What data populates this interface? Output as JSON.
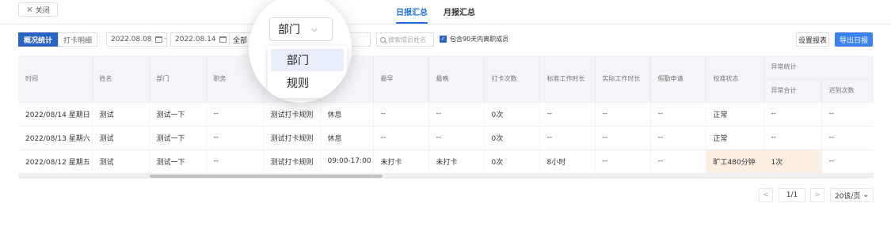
{
  "header": {
    "close_label": "关闭",
    "close_icon": "×",
    "tabs": [
      {
        "label": "日报汇总",
        "active": true
      },
      {
        "label": "月报汇总",
        "active": false
      }
    ]
  },
  "toolbar": {
    "view_tabs": [
      {
        "label": "概况统计",
        "active": true
      },
      {
        "label": "打卡明细",
        "active": false
      }
    ],
    "start_date": "2022.08.08",
    "date_separator": "-",
    "end_date": "2022.08.14",
    "scope_value": "全部",
    "search_placeholder": "搜索成员姓名",
    "include_left_label": "包含90天内离职成员",
    "include_left_checked": true,
    "settings_label": "设置报表",
    "export_label": "导出日报"
  },
  "magnifier": {
    "select_value": "部门",
    "options": [
      {
        "label": "部门",
        "selected": true
      },
      {
        "label": "规则",
        "selected": false
      }
    ]
  },
  "table": {
    "columns": [
      "时间",
      "姓名",
      "部门",
      "职务",
      "",
      "",
      "最早",
      "最晚",
      "打卡次数",
      "标准工作时长",
      "实际工作时长",
      "假勤申请",
      "校准状态"
    ],
    "group_header": "异常统计",
    "group_columns": [
      "异常合计",
      "迟到次数"
    ],
    "rows": [
      [
        "2022/08/14 星期日",
        "测试",
        "测试一下",
        "--",
        "测试打卡规则",
        "休息",
        "--",
        "--",
        "0次",
        "--",
        "--",
        "--",
        "正常",
        "--",
        "--"
      ],
      [
        "2022/08/13 星期六",
        "测试",
        "测试一下",
        "--",
        "测试打卡规则",
        "休息",
        "--",
        "--",
        "0次",
        "--",
        "--",
        "--",
        "正常",
        "--",
        "--"
      ],
      [
        "2022/08/12 星期五",
        "测试",
        "测试一下",
        "--",
        "测试打卡规则",
        "09:00-17:00",
        "未打卡",
        "未打卡",
        "0次",
        "8小时",
        "--",
        "--",
        "旷工480分钟",
        "1次",
        "--"
      ]
    ]
  },
  "pagination": {
    "prev": "<",
    "page": "1/1",
    "next": ">",
    "page_size": "20该/页",
    "page_size_icon": "⌄"
  },
  "colors": {
    "accent": "#1e6fd9",
    "primary_button": "#3b82f0",
    "warn_cell": "#fdeee2"
  }
}
